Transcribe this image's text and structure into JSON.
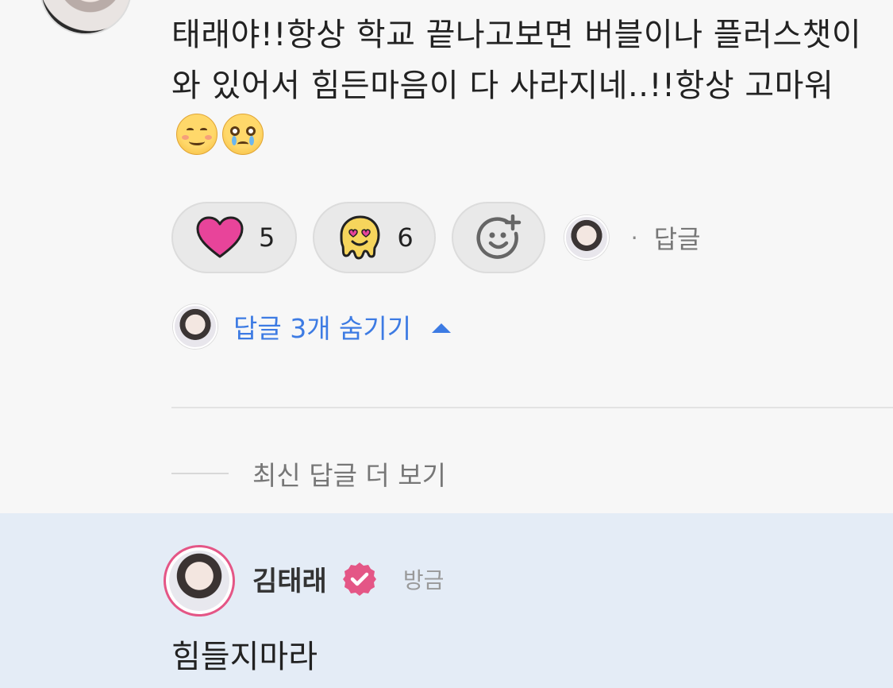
{
  "comment": {
    "text": "태래야!!항상 학교 끝나고보면 버블이나 플러스챗이 와 있어서 힘든마음이 다 사라지네..!!항상 고마워"
  },
  "reactions": {
    "heart": {
      "icon": "heart-icon",
      "count": "5",
      "color": "#e8449a"
    },
    "melt": {
      "icon": "melting-face-icon",
      "count": "6",
      "color": "#f6d55c"
    },
    "add_icon": "add-emoji-icon"
  },
  "actions": {
    "separator": "·",
    "reply_label": "답글",
    "hide_replies_label": "답글 3개 숨기기",
    "more_replies_label": "최신 답글 더 보기"
  },
  "reply": {
    "author": "김태래",
    "time": "방금",
    "text": "힘들지마라",
    "highlight_color": "#e4ecf6",
    "ring_color": "#e45686"
  },
  "colors": {
    "link_blue": "#3d7be3"
  }
}
